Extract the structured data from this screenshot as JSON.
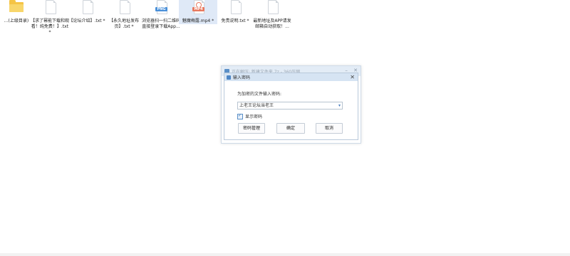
{
  "files": [
    {
      "label": "...(上级目录)",
      "type": "folder"
    },
    {
      "label": "【求了幂能下载和观看！纯免费！】.txt *",
      "type": "txt"
    },
    {
      "label": "【论坛介绍】.txt *",
      "type": "txt"
    },
    {
      "label": "【永久地址发布页】.txt *",
      "type": "txt"
    },
    {
      "label": "浏览器扫一扫二维码直接登录下载App...",
      "type": "png",
      "badge": "PNG"
    },
    {
      "label": "魅魔梅露.mp4 *",
      "type": "mp4",
      "badge": "MP4"
    },
    {
      "label": "免责说明.txt *",
      "type": "txt"
    },
    {
      "label": "最新地址及APP请发邮箱自动获取！...",
      "type": "txt"
    }
  ],
  "back_window": {
    "title": "正在解压: 新建文件夹.7z - 360压缩"
  },
  "dialog": {
    "title": "输入密码",
    "prompt": "为加密的文件输入密码:",
    "password_value": "上老王论坛当老王",
    "show_password_label": "显示密码",
    "show_password_checked": true,
    "buttons": {
      "manage": "密码管理",
      "ok": "确定",
      "cancel": "取消"
    }
  },
  "colors": {
    "accent": "#5a8fc7",
    "titlebar": "#d6e4f3",
    "folder": "#f5c445"
  }
}
